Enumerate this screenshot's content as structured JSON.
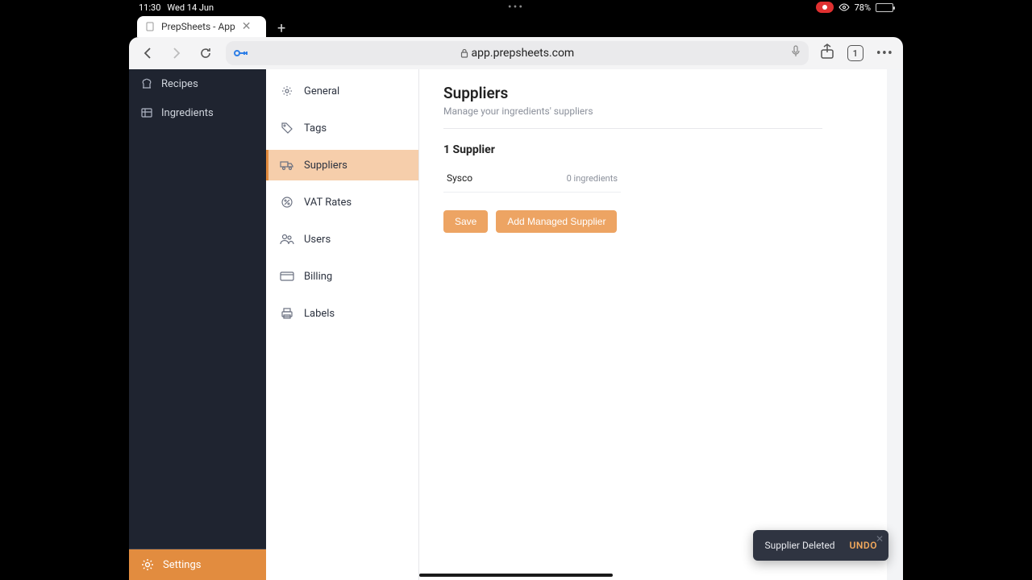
{
  "status": {
    "time": "11:30",
    "date": "Wed 14 Jun",
    "battery": "78%"
  },
  "tab": {
    "title": "PrepSheets - App"
  },
  "url": "app.prepsheets.com",
  "tab_count": "1",
  "leftnav": {
    "recipes": "Recipes",
    "ingredients": "Ingredients",
    "settings": "Settings"
  },
  "subnav": {
    "general": "General",
    "tags": "Tags",
    "suppliers": "Suppliers",
    "vat": "VAT Rates",
    "users": "Users",
    "billing": "Billing",
    "labels": "Labels"
  },
  "page": {
    "title": "Suppliers",
    "subtitle": "Manage your ingredients' suppliers",
    "count": "1 Supplier"
  },
  "supplier_row": {
    "name": "Sysco",
    "meta": "0 ingredients"
  },
  "buttons": {
    "save": "Save",
    "add": "Add Managed Supplier"
  },
  "toast": {
    "message": "Supplier Deleted",
    "undo": "UNDO"
  }
}
